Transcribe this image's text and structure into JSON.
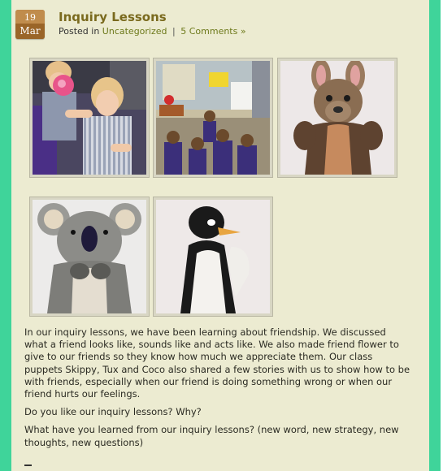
{
  "post": {
    "date_day": "19",
    "date_month": "Mar",
    "title": "Inquiry Lessons",
    "posted_in_label": "Posted in",
    "category": "Uncategorized",
    "separator": "|",
    "comments_link": "5 Comments »"
  },
  "gallery": [
    {
      "name": "photo-children-with-puppet",
      "icon": "photo-children"
    },
    {
      "name": "photo-classroom-group",
      "icon": "photo-classroom"
    },
    {
      "name": "photo-kangaroo-puppet",
      "icon": "photo-kangaroo"
    },
    {
      "name": "photo-koala-puppet",
      "icon": "photo-koala"
    },
    {
      "name": "photo-penguin-puppet",
      "icon": "photo-penguin"
    }
  ],
  "article": {
    "paragraph_1": "In our inquiry lessons, we have been learning about friendship. We discussed what a friend looks like, sounds like and acts like. We also made friend flower to give to our friends so they know how much we appreciate them. Our class puppets Skippy, Tux and Coco also shared a few stories with us to show how to be with friends, especially when our friend is doing something wrong or when our friend hurts our feelings.",
    "paragraph_2": "Do you like our inquiry lessons? Why?",
    "paragraph_3": "What have you learned from our inquiry lessons? (new word, new strategy, new thoughts, new questions)"
  },
  "colors": {
    "frame": "#3fd49a",
    "paper": "#ecebd1",
    "title": "#7a6a1e",
    "link": "#6e7a1c",
    "badge": "#b07a3a"
  }
}
